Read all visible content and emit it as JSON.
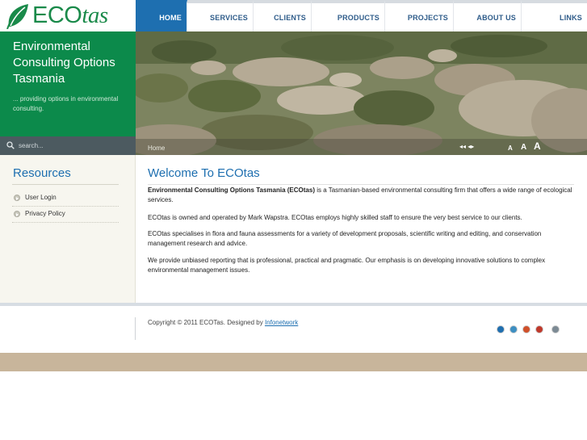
{
  "brand": {
    "logo_eco": "ECO",
    "logo_tas": "tas",
    "green": "#0c8a4b",
    "blue": "#1e6fb0"
  },
  "nav": {
    "items": [
      {
        "label": "HOME",
        "active": true
      },
      {
        "label": "SERVICES",
        "active": false
      },
      {
        "label": "CLIENTS",
        "active": false
      },
      {
        "label": "PRODUCTS",
        "active": false
      },
      {
        "label": "PROJECTS",
        "active": false
      },
      {
        "label": "ABOUT US",
        "active": false
      },
      {
        "label": "LINKS",
        "active": false
      }
    ]
  },
  "intro": {
    "title": "Environmental Consulting Options Tasmania",
    "subtitle": "... providing options in environmental consulting."
  },
  "search": {
    "placeholder": "search..."
  },
  "hero": {
    "breadcrumb": "Home",
    "controls": "◂◂  ◂▸",
    "font_small": "A",
    "font_medium": "A",
    "font_large": "A"
  },
  "sidebar": {
    "title": "Resources",
    "links": [
      {
        "label": "User Login"
      },
      {
        "label": "Privacy Policy"
      }
    ]
  },
  "main": {
    "title": "Welcome To ECOtas",
    "p1_bold": "Environmental Consulting Options Tasmania (ECOtas)",
    "p1_rest": " is a Tasmanian-based environmental consulting firm that offers a wide range of ecological services.",
    "p2": "ECOtas is owned and operated by Mark Wapstra. ECOtas employs highly skilled staff to ensure the very best service to our clients.",
    "p3": "ECOtas specialises in flora and fauna assessments for a variety of development proposals, scientific writing and editing, and conservation management research and advice.",
    "p4": "We provide unbiased reporting that is professional, practical and pragmatic. Our emphasis is on developing innovative solutions to complex environmental management issues."
  },
  "footer": {
    "copyright": "Copyright © 2011 ECOTas. Designed by ",
    "designer": "Infonetwork",
    "dot_colors": [
      "#1f6fb0",
      "#3d8fc2",
      "#d0502a",
      "#c0392b",
      "#7c8a94"
    ]
  }
}
